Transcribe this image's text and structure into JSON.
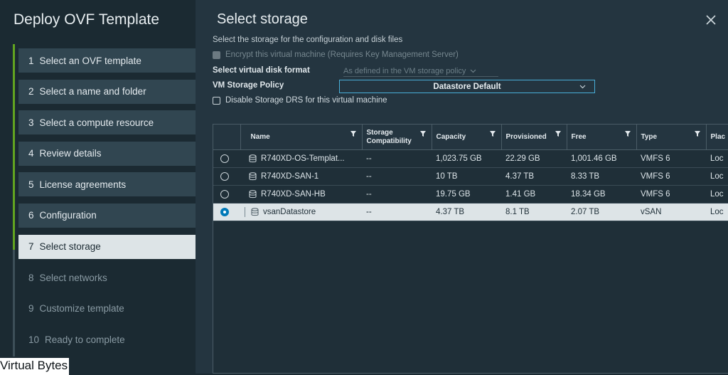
{
  "wizard": {
    "title": "Deploy OVF Template",
    "steps": [
      {
        "num": "1",
        "label": "Select an OVF template"
      },
      {
        "num": "2",
        "label": "Select a name and folder"
      },
      {
        "num": "3",
        "label": "Select a compute resource"
      },
      {
        "num": "4",
        "label": "Review details"
      },
      {
        "num": "5",
        "label": "License agreements"
      },
      {
        "num": "6",
        "label": "Configuration"
      },
      {
        "num": "7",
        "label": "Select storage"
      },
      {
        "num": "8",
        "label": "Select networks"
      },
      {
        "num": "9",
        "label": "Customize template"
      },
      {
        "num": "10",
        "label": "Ready to complete"
      }
    ],
    "active_step": 7
  },
  "watermark": "Virtual Bytes",
  "page": {
    "title": "Select storage",
    "subtitle": "Select the storage for the configuration and disk files",
    "encrypt_label": "Encrypt this virtual machine (Requires Key Management Server)",
    "disk_format_label": "Select virtual disk format",
    "disk_format_value": "As defined in the VM storage policy",
    "policy_label": "VM Storage Policy",
    "policy_value": "Datastore Default",
    "drs_label": "Disable Storage DRS for this virtual machine"
  },
  "table": {
    "columns": [
      "Name",
      "Storage Compatibility",
      "Capacity",
      "Provisioned",
      "Free",
      "Type",
      "Plac"
    ],
    "rows": [
      {
        "name": "R740XD-OS-Templat...",
        "compat": "--",
        "capacity": "1,023.75 GB",
        "provisioned": "22.29 GB",
        "free": "1,001.46 GB",
        "type": "VMFS 6",
        "place": "Loc"
      },
      {
        "name": "R740XD-SAN-1",
        "compat": "--",
        "capacity": "10 TB",
        "provisioned": "4.37 TB",
        "free": "8.33 TB",
        "type": "VMFS 6",
        "place": "Loc"
      },
      {
        "name": "R740XD-SAN-HB",
        "compat": "--",
        "capacity": "19.75 GB",
        "provisioned": "1.41 GB",
        "free": "18.34 GB",
        "type": "VMFS 6",
        "place": "Loc"
      },
      {
        "name": "vsanDatastore",
        "compat": "--",
        "capacity": "4.37 TB",
        "provisioned": "8.1 TB",
        "free": "2.07 TB",
        "type": "vSAN",
        "place": "Loc"
      }
    ],
    "selected_row": 3
  },
  "colors": {
    "accent": "#0079b8",
    "progress": "#62a420",
    "sidebar_item": "#314651",
    "active_item": "#dde4e7"
  }
}
